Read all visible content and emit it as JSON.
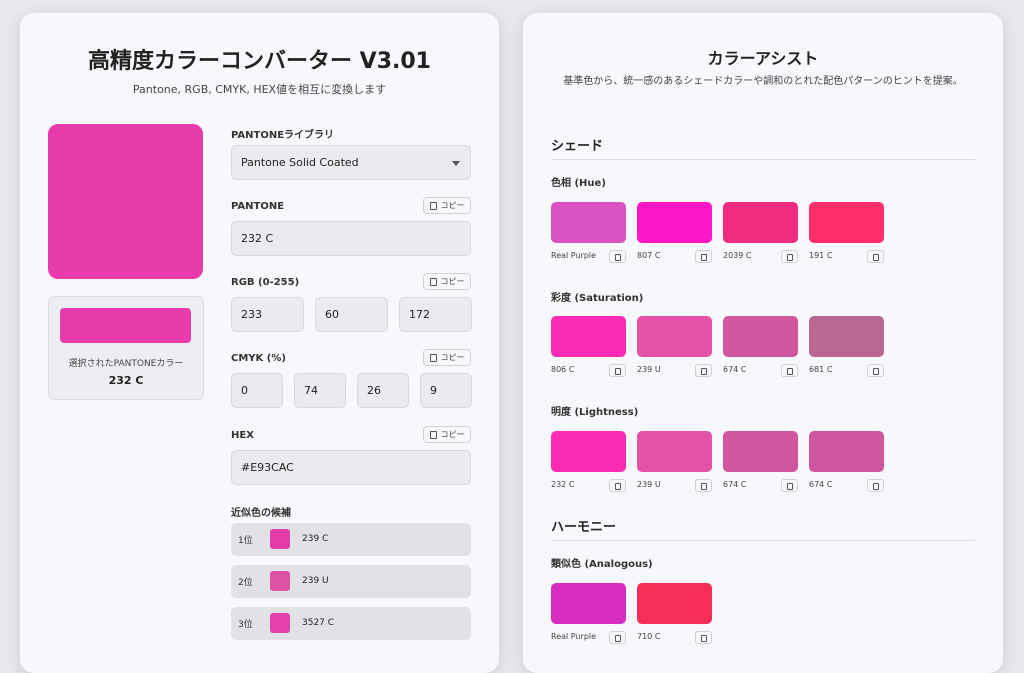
{
  "left": {
    "title": "高精度カラーコンバーター V3.01",
    "subtitle": "Pantone, RGB, CMYK, HEX値を相互に変換します",
    "preview_color": "#E93CAC",
    "selected": {
      "label": "選択されたPANTONEカラー",
      "value": "232 C"
    },
    "library": {
      "label": "PANTONEライブラリ",
      "value": "Pantone Solid Coated"
    },
    "copy_label": "コピー",
    "pantone": {
      "label": "PANTONE",
      "value": "232 C"
    },
    "rgb": {
      "label": "RGB (0-255)",
      "r": "233",
      "g": "60",
      "b": "172"
    },
    "cmyk": {
      "label": "CMYK (%)",
      "c": "0",
      "m": "74",
      "y": "26",
      "k": "9"
    },
    "hex": {
      "label": "HEX",
      "value": "#E93CAC"
    },
    "candidates": {
      "label": "近似色の候補",
      "items": [
        {
          "rank": "1位",
          "name": "239 C",
          "color": "#E33CA8"
        },
        {
          "rank": "2位",
          "name": "239 U",
          "color": "#E052A6"
        },
        {
          "rank": "3位",
          "name": "3527 C",
          "color": "#E33FAD"
        }
      ]
    }
  },
  "right": {
    "title": "カラーアシスト",
    "description": "基準色から、統一感のあるシェードカラーや調和のとれた配色パターンのヒントを提案。",
    "shade_heading": "シェード",
    "harmony_heading": "ハーモニー",
    "groups": [
      {
        "label": "色相 (Hue)",
        "items": [
          {
            "name": "Real Purple",
            "color": "#DB52C3"
          },
          {
            "name": "807 C",
            "color": "#FC16C5"
          },
          {
            "name": "2039 C",
            "color": "#EF2C7F"
          },
          {
            "name": "191 C",
            "color": "#FD2E69"
          }
        ]
      },
      {
        "label": "彩度 (Saturation)",
        "items": [
          {
            "name": "806 C",
            "color": "#FC2BB3"
          },
          {
            "name": "239 U",
            "color": "#E452A7"
          },
          {
            "name": "674 C",
            "color": "#D0579D"
          },
          {
            "name": "681 C",
            "color": "#BA6891"
          }
        ]
      },
      {
        "label": "明度 (Lightness)",
        "items": [
          {
            "name": "232 C",
            "color": "#FC2BB3"
          },
          {
            "name": "239 U",
            "color": "#E452A7"
          },
          {
            "name": "674 C",
            "color": "#D0579D"
          },
          {
            "name": "674 C",
            "color": "#D0579D"
          }
        ]
      }
    ],
    "harmony_groups": [
      {
        "label": "類似色 (Analogous)",
        "items": [
          {
            "name": "Real Purple",
            "color": "#D62CC0"
          },
          {
            "name": "710 C",
            "color": "#F52D57"
          }
        ]
      }
    ]
  }
}
